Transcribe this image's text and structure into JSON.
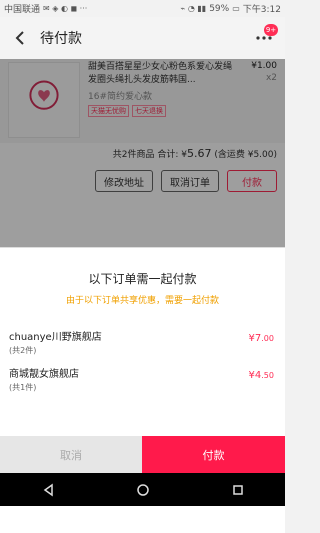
{
  "status_bar": {
    "carrier": "中国联通",
    "battery": "59%",
    "time": "下午3:12"
  },
  "header": {
    "title": "待付款",
    "badge": "9+"
  },
  "order": {
    "product_title": "甜美百搭星星少女心粉色系爱心发绳发圈头绳扎头发皮筋韩国...",
    "spec": "16#简约爱心款",
    "tags": [
      "天猫无忧购",
      "七天退换"
    ],
    "price": "¥1.00",
    "quantity": "x2",
    "summary_text": "共2件商品  合计: ¥",
    "summary_amount": "5.67",
    "summary_shipping": "(含运费 ¥5.00)",
    "buttons": {
      "modify_address": "修改地址",
      "cancel_order": "取消订单",
      "pay": "付款"
    }
  },
  "sheet": {
    "title": "以下订单需一起付款",
    "note": "由于以下订单共享优惠，需要一起付款",
    "stores": [
      {
        "name": "chuanye川野旗舰店",
        "count": "(共2件)",
        "currency": "¥",
        "price_int": "7",
        "price_dec": ".00"
      },
      {
        "name": "商城靓女旗舰店",
        "count": "(共1件)",
        "currency": "¥",
        "price_int": "4",
        "price_dec": ".50"
      }
    ]
  },
  "footer": {
    "cancel": "取消",
    "pay": "付款"
  },
  "icons": {
    "back": "back-arrow-icon",
    "menu": "more-icon",
    "nav_back": "nav-back-icon",
    "nav_home": "nav-home-icon",
    "nav_recent": "nav-recent-icon"
  },
  "colors": {
    "accent": "#ff1a4b",
    "note": "#f0a000"
  }
}
